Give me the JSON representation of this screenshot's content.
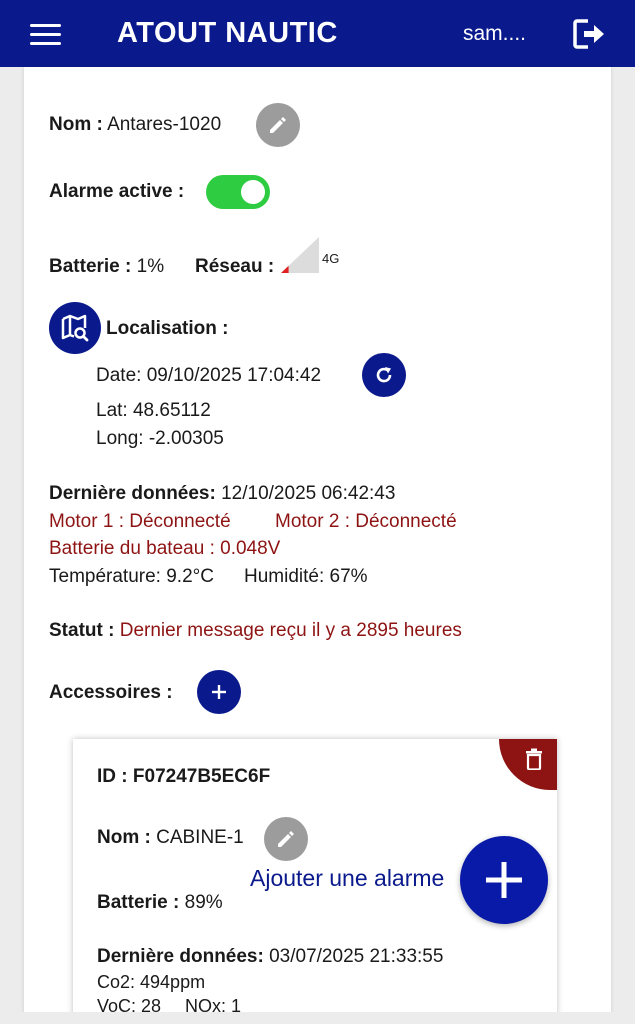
{
  "header": {
    "brand": "ATOUT NAUTIC",
    "user": "sam....",
    "menu_icon": "hamburger-menu-icon",
    "logout_icon": "logout-icon"
  },
  "device": {
    "name_label": "Nom :",
    "name_value": "Antares-1020",
    "alarm_label": "Alarme active :",
    "alarm_active": true,
    "battery_label": "Batterie :",
    "battery_value": "1%",
    "network_label": "Réseau :",
    "network_type": "4G",
    "network_level": 0.2
  },
  "location": {
    "title": "Localisation :",
    "date": "Date: 09/10/2025 17:04:42",
    "lat": "Lat: 48.65112",
    "long": "Long: -2.00305"
  },
  "last_data": {
    "label": "Dernière données:",
    "value": "12/10/2025 06:42:43",
    "motor1": "Motor 1 : Déconnecté",
    "motor2": "Motor 2 : Déconnecté",
    "boat_battery": "Batterie du bateau : 0.048V",
    "temperature": "Température: 9.2°C",
    "humidity": "Humidité: 67%"
  },
  "status": {
    "label": "Statut :",
    "value": "Dernier message reçu il y a 2895 heures"
  },
  "accessories": {
    "label": "Accessoires :",
    "items": [
      {
        "id_label": "ID :",
        "id_value": "F07247B5EC6F",
        "name_label": "Nom :",
        "name_value": "CABINE-1",
        "battery_label": "Batterie :",
        "battery_value": "89%",
        "last_data_label": "Dernière données:",
        "last_data_value": "03/07/2025 21:33:55",
        "co2": "Co2: 494ppm",
        "voc": "VoC: 28",
        "nox": "NOx: 1"
      }
    ]
  },
  "add_alarm": {
    "label": "Ajouter une alarme"
  },
  "colors": {
    "primary": "#0a1a8c",
    "danger": "#8e1414",
    "toggle_on": "#2ecc40"
  }
}
